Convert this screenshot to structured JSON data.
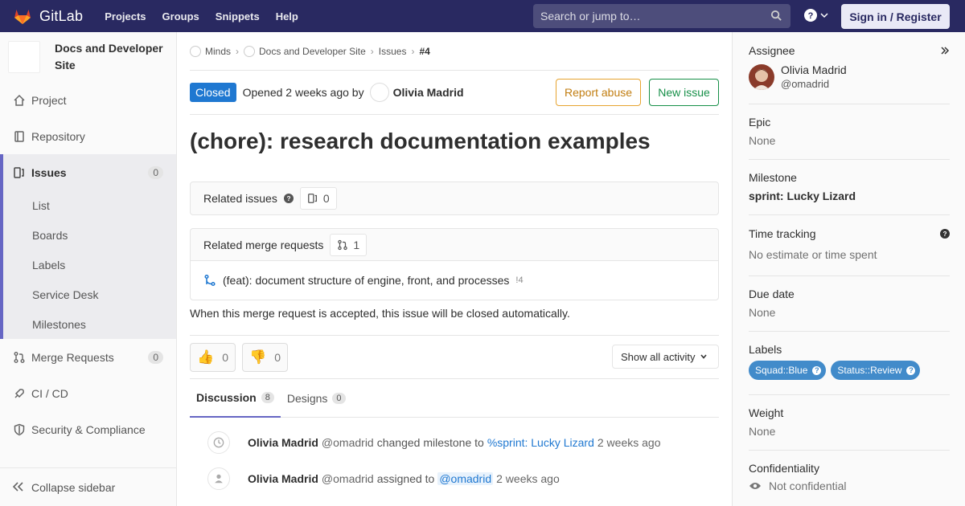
{
  "navbar": {
    "brand": "GitLab",
    "links": [
      "Projects",
      "Groups",
      "Snippets",
      "Help"
    ],
    "search_placeholder": "Search or jump to…",
    "signin": "Sign in / Register"
  },
  "sidebar": {
    "project_name": "Docs and Developer Site",
    "items": [
      {
        "label": "Project",
        "icon": "home-icon"
      },
      {
        "label": "Repository",
        "icon": "book-icon"
      },
      {
        "label": "Issues",
        "icon": "issues-icon",
        "count": "0"
      }
    ],
    "sub_items": [
      "List",
      "Boards",
      "Labels",
      "Service Desk",
      "Milestones"
    ],
    "items_after": [
      {
        "label": "Merge Requests",
        "icon": "merge-request-icon",
        "count": "0"
      },
      {
        "label": "CI / CD",
        "icon": "rocket-icon"
      },
      {
        "label": "Security & Compliance",
        "icon": "shield-icon"
      }
    ],
    "collapse": "Collapse sidebar"
  },
  "breadcrumb": [
    "Minds",
    "Docs and Developer Site",
    "Issues",
    "#4"
  ],
  "issue": {
    "status": "Closed",
    "opened_text": "Opened 2 weeks ago by",
    "author": "Olivia Madrid",
    "report_abuse": "Report abuse",
    "new_issue": "New issue",
    "title": "(chore): research documentation examples",
    "related_issues_label": "Related issues",
    "related_issues_count": "0",
    "related_mr_label": "Related merge requests",
    "related_mr_count": "1",
    "mr_title": "(feat): document structure of engine, front, and processes",
    "mr_ref": "!4",
    "auto_close_text": "When this merge request is accepted, this issue will be closed automatically.",
    "thumbs_up": "0",
    "thumbs_down": "0",
    "activity_filter": "Show all activity",
    "tabs": [
      {
        "label": "Discussion",
        "count": "8"
      },
      {
        "label": "Designs",
        "count": "0"
      }
    ],
    "notes": [
      {
        "author": "Olivia Madrid",
        "handle": "@omadrid",
        "text": "changed milestone to",
        "link": "%sprint: Lucky Lizard",
        "time": "2 weeks ago",
        "icon": "clock-icon"
      },
      {
        "author": "Olivia Madrid",
        "handle": "@omadrid",
        "text": "assigned to",
        "mention": "@omadrid",
        "time": "2 weeks ago",
        "icon": "user-icon"
      }
    ]
  },
  "right_sidebar": {
    "assignee_title": "Assignee",
    "assignee_name": "Olivia Madrid",
    "assignee_handle": "@omadrid",
    "epic_title": "Epic",
    "epic_value": "None",
    "milestone_title": "Milestone",
    "milestone_value": "sprint: Lucky Lizard",
    "time_title": "Time tracking",
    "time_value": "No estimate or time spent",
    "due_title": "Due date",
    "due_value": "None",
    "labels_title": "Labels",
    "labels": [
      "Squad::Blue",
      "Status::Review"
    ],
    "weight_title": "Weight",
    "weight_value": "None",
    "conf_title": "Confidentiality",
    "conf_value": "Not confidential"
  },
  "colors": {
    "navbar": "#292961",
    "accent": "#6666c4",
    "closed": "#1f78d1",
    "label": "#428bca"
  }
}
